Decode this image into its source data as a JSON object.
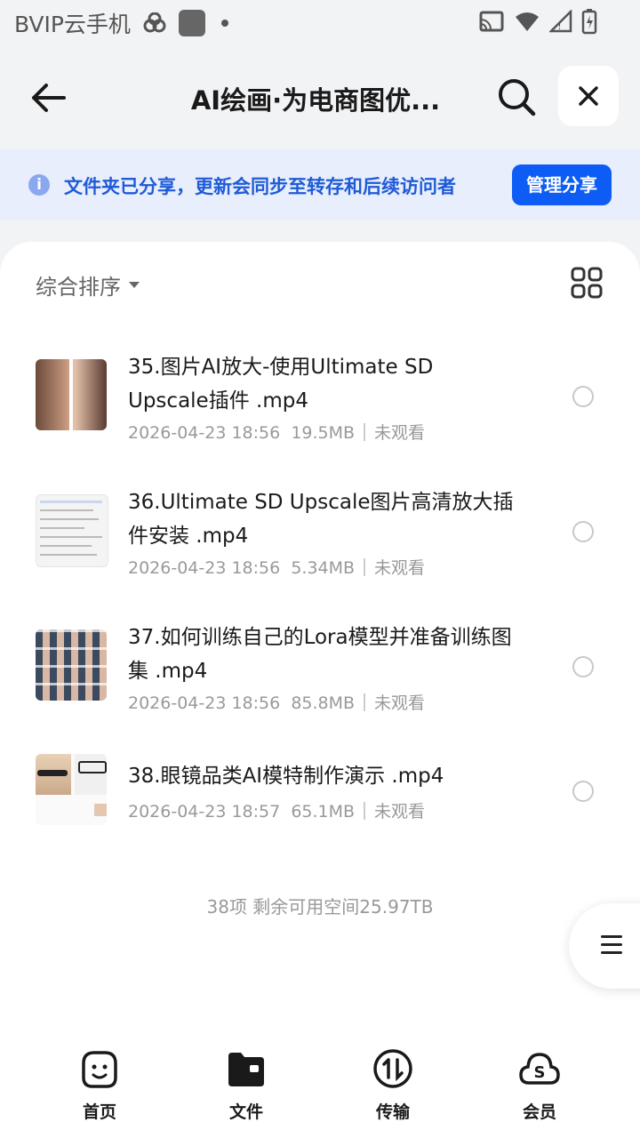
{
  "status_bar": {
    "carrier": "BVIP云手机"
  },
  "header": {
    "title": "AI绘画·为电商图优..."
  },
  "banner": {
    "text": "文件夹已分享，更新会同步至转存和后续访问者",
    "button": "管理分享"
  },
  "sort": {
    "label": "综合排序"
  },
  "files": [
    {
      "name": "35.图片AI放大-使用Ultimate SD Upscale插件 .mp4",
      "date": "2026-04-23 18:56",
      "size": "19.5MB",
      "status": "未观看"
    },
    {
      "name": "36.Ultimate SD Upscale图片高清放大插件安装 .mp4",
      "date": "2026-04-23 18:56",
      "size": "5.34MB",
      "status": "未观看"
    },
    {
      "name": "37.如何训练自己的Lora模型并准备训练图集 .mp4",
      "date": "2026-04-23 18:56",
      "size": "85.8MB",
      "status": "未观看"
    },
    {
      "name": "38.眼镜品类AI模特制作演示 .mp4",
      "date": "2026-04-23 18:57",
      "size": "65.1MB",
      "status": "未观看"
    }
  ],
  "footer": {
    "summary": "38项 剩余可用空间25.97TB"
  },
  "tabs": [
    {
      "label": "首页",
      "icon": "smile-face-icon"
    },
    {
      "label": "文件",
      "icon": "folder-icon"
    },
    {
      "label": "传输",
      "icon": "transfer-icon"
    },
    {
      "label": "会员",
      "icon": "cloud-vip-icon"
    }
  ],
  "colors": {
    "accent": "#0d5cf5",
    "banner_bg": "#e8eefb",
    "banner_text": "#1f5bd8"
  }
}
